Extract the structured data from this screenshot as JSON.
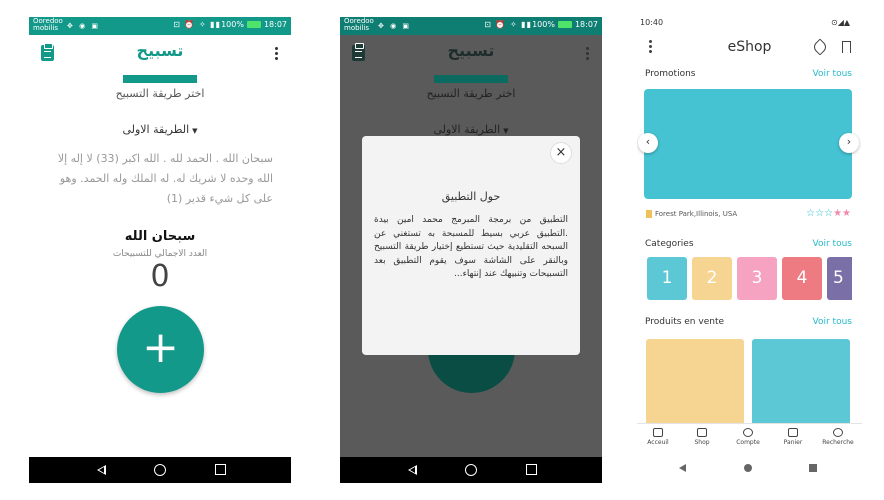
{
  "tasbeeh": {
    "status": {
      "carrier": "Ooredoo\nmobilis",
      "battery": "100%",
      "time": "18:07"
    },
    "title": "تسبيح",
    "choose_method": "اختر طريقة التسبيح",
    "method_selected": "الطريقة الاولى",
    "dhikr_text": "سبحان الله . الحمد لله . الله اكبر (33) لا إله إلا الله وحده لا شريك له. له الملك وله الحمد. وهو على كل شيء قدير (1)",
    "current_phrase": "سبحان الله",
    "total_label": "العدد الاجمالي للتسبيحات",
    "count": "0",
    "add_symbol": "+"
  },
  "about_dialog": {
    "status": {
      "carrier": "Ooredoo\nmobilis",
      "battery": "100%",
      "time": "18:07"
    },
    "bg_title": "تسبيح",
    "bg_choose": "اختر طريقة التسبيح",
    "bg_method": "الطريقة الاولى",
    "close_symbol": "×",
    "title": "حول التطبيق",
    "body": "التطبيق من برمجة المبرمج محمد امين بيدة .التطبيق عربي بسيط للمسبحة به تستغني عن السبحه التقليدية حيث تستطيع إختيار طريقة التسبيح وبالنقر على الشاشة سوف يقوم التطبيق بعد التسبيحات وتنبيهك عند إنتهاء..."
  },
  "eshop": {
    "status_time": "10:40",
    "title": "eShop",
    "promotions": {
      "title": "Promotions",
      "link": "Voir tous",
      "location": "Forest Park,Illinois, USA"
    },
    "categories": {
      "title": "Categories",
      "link": "Voir tous",
      "items": [
        "1",
        "2",
        "3",
        "4",
        "5"
      ]
    },
    "products": {
      "title": "Produits en vente",
      "link": "Voir tous"
    },
    "bottom_nav": [
      "Acceuil",
      "Shop",
      "Compte",
      "Panier",
      "Recherche"
    ],
    "colors": {
      "teal": "#45c3d3",
      "yellow": "#f6d592",
      "pink": "#f5a3c0",
      "red": "#ef7b82",
      "purple": "#7b6fa8",
      "accent": "#26b9c9"
    }
  }
}
